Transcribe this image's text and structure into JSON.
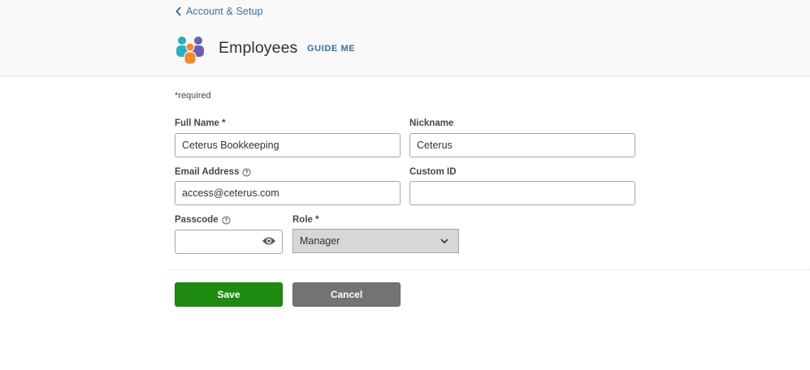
{
  "header": {
    "back_link": "Account & Setup",
    "title": "Employees",
    "guide_me": "GUIDE ME",
    "icon": "people-group-icon"
  },
  "form": {
    "required_note": "*required",
    "full_name": {
      "label": "Full Name *",
      "value": "Ceterus Bookkeeping"
    },
    "nickname": {
      "label": "Nickname",
      "value": "Ceterus"
    },
    "email": {
      "label": "Email Address",
      "value": "access@ceterus.com"
    },
    "custom_id": {
      "label": "Custom ID",
      "value": ""
    },
    "passcode": {
      "label": "Passcode",
      "value": ""
    },
    "role": {
      "label": "Role *",
      "selected": "Manager"
    }
  },
  "buttons": {
    "save": "Save",
    "cancel": "Cancel"
  },
  "colors": {
    "link": "#3c6e9e",
    "save": "#1e8a10",
    "cancel": "#737373"
  }
}
